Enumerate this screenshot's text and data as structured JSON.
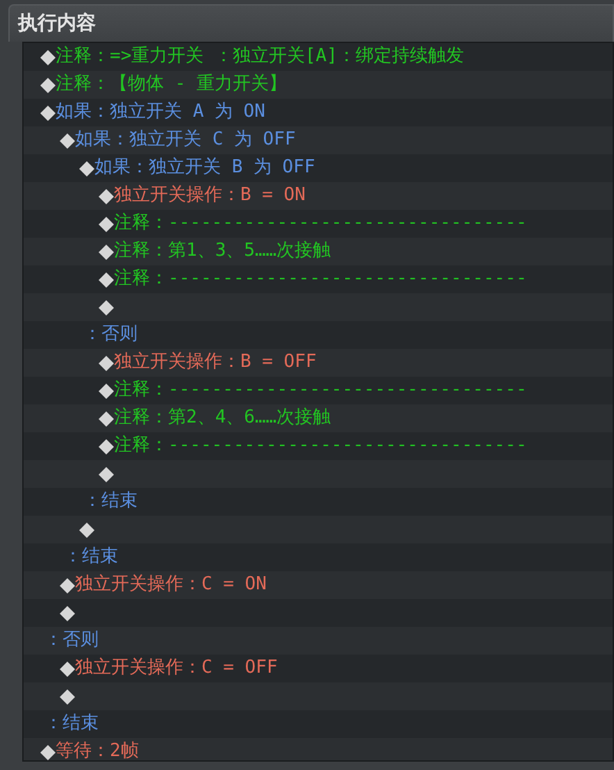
{
  "panel": {
    "title": "执行内容"
  },
  "commands": [
    {
      "kind": "comment",
      "text": "注释：=>重力开关 ：独立开关[A]：绑定持续触发"
    },
    {
      "kind": "comment",
      "text": "注释：【物体 - 重力开关】"
    },
    {
      "kind": "condition",
      "text": "如果：独立开关 A 为 ON",
      "children": [
        {
          "kind": "condition",
          "text": "如果：独立开关 C 为 OFF",
          "children": [
            {
              "kind": "condition",
              "text": "如果：独立开关 B 为 OFF",
              "children": [
                {
                  "kind": "operation",
                  "text": "独立开关操作：B = ON"
                },
                {
                  "kind": "comment",
                  "text": "注释：---------------------------------"
                },
                {
                  "kind": "comment",
                  "text": "注释：第1、3、5……次接触"
                },
                {
                  "kind": "comment",
                  "text": "注释：---------------------------------"
                },
                {
                  "kind": "empty"
                }
              ]
            },
            {
              "kind": "branch",
              "text": "：否则",
              "children": [
                {
                  "kind": "operation",
                  "text": "独立开关操作：B = OFF"
                },
                {
                  "kind": "comment",
                  "text": "注释：---------------------------------"
                },
                {
                  "kind": "comment",
                  "text": "注释：第2、4、6……次接触"
                },
                {
                  "kind": "comment",
                  "text": "注释：---------------------------------"
                },
                {
                  "kind": "empty"
                }
              ]
            },
            {
              "kind": "branch",
              "text": "：结束"
            },
            {
              "kind": "empty"
            }
          ]
        },
        {
          "kind": "branch",
          "text": "：结束"
        },
        {
          "kind": "operation",
          "text": "独立开关操作：C = ON"
        },
        {
          "kind": "empty"
        }
      ]
    },
    {
      "kind": "branch",
      "text": "：否则",
      "children": [
        {
          "kind": "operation",
          "text": "独立开关操作：C = OFF"
        },
        {
          "kind": "empty"
        }
      ]
    },
    {
      "kind": "branch",
      "text": "：结束"
    },
    {
      "kind": "operation",
      "text": "等待：2帧"
    }
  ]
}
